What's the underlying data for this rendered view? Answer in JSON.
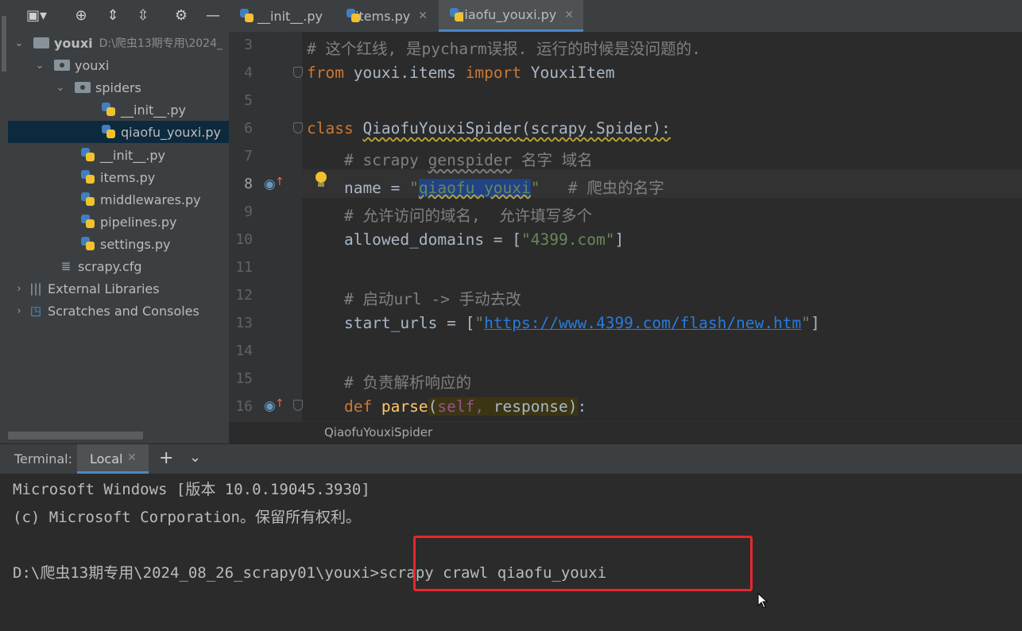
{
  "tabs": [
    {
      "label": "__init__.py",
      "active": false
    },
    {
      "label": "items.py",
      "active": false
    },
    {
      "label": "qiaofu_youxi.py",
      "active": true
    }
  ],
  "tree": {
    "root_name": "youxi",
    "root_path": "D:\\爬虫13期专用\\2024_",
    "pkg": "youxi",
    "spiders": "spiders",
    "spider_init": "__init__.py",
    "spider_file": "qiaofu_youxi.py",
    "init": "__init__.py",
    "items": "items.py",
    "middlewares": "middlewares.py",
    "pipelines": "pipelines.py",
    "settings": "settings.py",
    "cfg": "scrapy.cfg",
    "ext_libs": "External Libraries",
    "scratches": "Scratches and Consoles"
  },
  "code": {
    "line_numbers": [
      "3",
      "4",
      "5",
      "6",
      "7",
      "8",
      "9",
      "10",
      "11",
      "12",
      "13",
      "14",
      "15",
      "16"
    ],
    "l3": "# 这个红线, 是pycharm误报. 运行的时候是没问题的.",
    "l4_from": "from",
    "l4_mod": " youxi.items ",
    "l4_import": "import",
    "l4_name": " YouxiItem",
    "l6_kw": "class",
    "l6_cls": "QiaofuYouxiSpider",
    "l6_rest": "(scrapy.Spider):",
    "l7_a": "    # scrapy ",
    "l7_b": "genspider",
    "l7_c": " 名字 域名",
    "l8_a": "    name = ",
    "l8_q1": "\"",
    "l8_val": "qiaofu_youxi",
    "l8_q2": "\"",
    "l8_cm": "   # 爬虫的名字",
    "l9": "    # 允许访问的域名,  允许填写多个",
    "l10_a": "    allowed_domains = [",
    "l10_str": "\"4399.com\"",
    "l10_b": "]",
    "l12": "    # 启动url -> 手动去改",
    "l13_a": "    start_urls = [",
    "l13_q1": "\"",
    "l13_url": "https://www.4399.com/flash/new.htm",
    "l13_q2": "\"",
    "l13_b": "]",
    "l15": "    # 负责解析响应的",
    "l16_kw": "    def ",
    "l16_fn": "parse",
    "l16_p1": "(",
    "l16_self": "self,",
    "l16_rest": " response",
    "l16_p2": ")",
    "l16_colon": ":"
  },
  "breadcrumb": "QiaofuYouxiSpider",
  "terminal": {
    "title": "Terminal:",
    "tab_label": "Local",
    "line1": "Microsoft Windows [版本 10.0.19045.3930]",
    "line2": "(c) Microsoft Corporation。保留所有权利。",
    "prompt": "D:\\爬虫13期专用\\2024_08_26_scrapy01\\youxi>",
    "command": "scrapy crawl qiaofu_youxi"
  },
  "colors": {
    "highlight_box": "#e8262e",
    "active_tab_underline": "#4a88c7",
    "selection": "#0d293e"
  }
}
